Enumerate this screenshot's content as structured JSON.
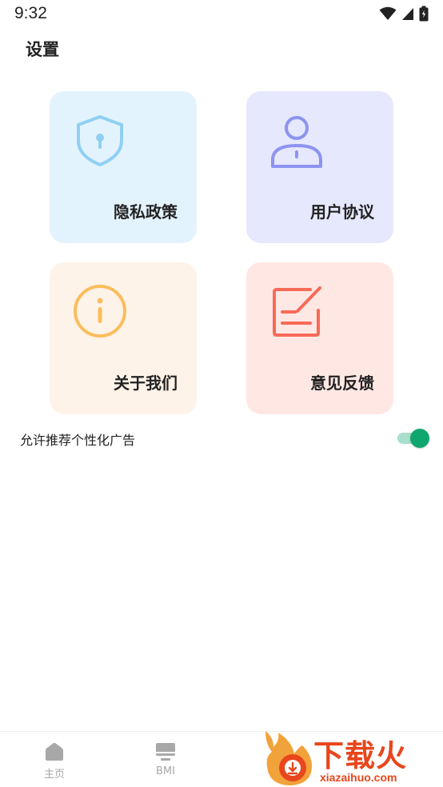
{
  "status_bar": {
    "time": "9:32",
    "icons": [
      "wifi-icon",
      "cellular-signal-icon",
      "battery-icon"
    ]
  },
  "header": {
    "title": "设置"
  },
  "cards": [
    {
      "id": "privacy-policy",
      "label": "隐私政策",
      "icon": "shield-lock-icon",
      "color": "#8fd0f3",
      "background": "#e3f3fd"
    },
    {
      "id": "user-agreement",
      "label": "用户协议",
      "icon": "user-icon",
      "color": "#8d94ef",
      "background": "#e6e8fd"
    },
    {
      "id": "about-us",
      "label": "关于我们",
      "icon": "info-icon",
      "color": "#fbbd5c",
      "background": "#fef3e9"
    },
    {
      "id": "feedback",
      "label": "意见反馈",
      "icon": "edit-note-icon",
      "color": "#f76a58",
      "background": "#ffe8e4"
    }
  ],
  "settings": {
    "personalized_ads": {
      "label": "允许推荐个性化广告",
      "enabled": true,
      "accent": "#10a66f"
    }
  },
  "tab_bar": {
    "items": [
      {
        "label": "主页",
        "icon": "home-icon"
      },
      {
        "label": "BMI",
        "icon": "monitor-icon"
      }
    ]
  },
  "watermark": {
    "brand": "下载火",
    "url": "xiazaihuo.com",
    "color": "#e8461c"
  }
}
